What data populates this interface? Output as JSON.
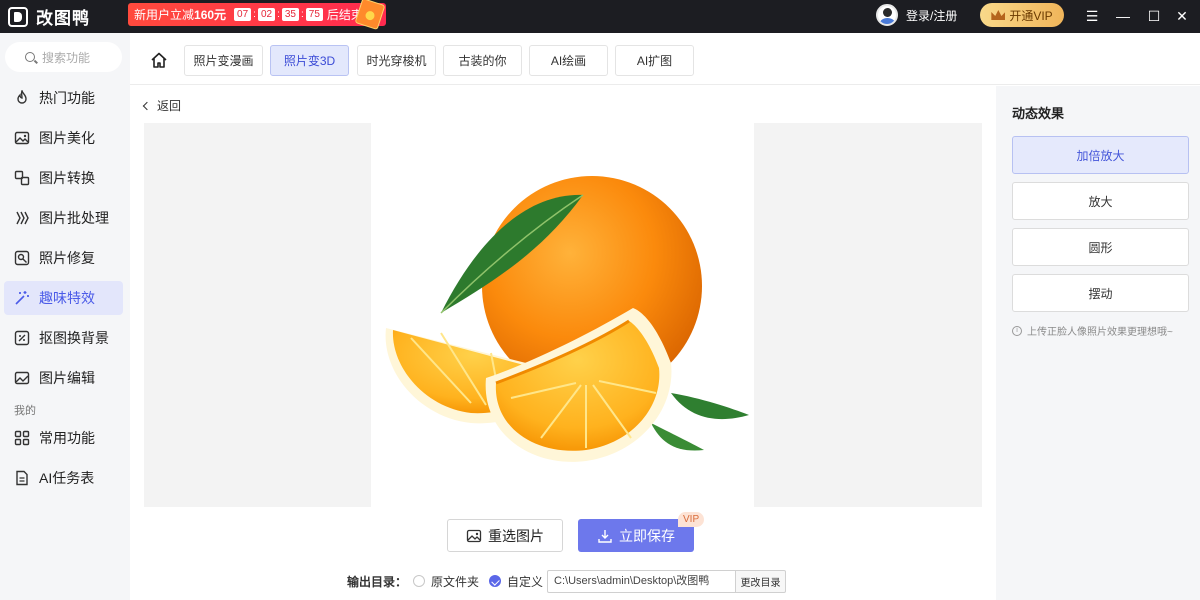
{
  "app": {
    "name": "改图鸭"
  },
  "promo": {
    "text": "新用户立减",
    "amount": "160元",
    "countdown": [
      "07",
      "02",
      "35",
      "75"
    ],
    "suffix": "后结束"
  },
  "user": {
    "login": "登录/注册"
  },
  "vip": {
    "label": "开通VIP"
  },
  "window": {
    "menu": "☰",
    "minimize": "—",
    "maximize": "☐",
    "close": "✕"
  },
  "sidebar": {
    "search_placeholder": "搜索功能",
    "items": [
      {
        "label": "热门功能",
        "icon": "flame-icon"
      },
      {
        "label": "图片美化",
        "icon": "image-beautify-icon"
      },
      {
        "label": "图片转换",
        "icon": "convert-icon"
      },
      {
        "label": "图片批处理",
        "icon": "batch-icon"
      },
      {
        "label": "照片修复",
        "icon": "photo-repair-icon"
      },
      {
        "label": "趣味特效",
        "icon": "magic-wand-icon",
        "active": true
      },
      {
        "label": "抠图换背景",
        "icon": "cutout-icon"
      },
      {
        "label": "图片编辑",
        "icon": "image-edit-icon"
      }
    ],
    "section_label": "我的",
    "my_items": [
      {
        "label": "常用功能",
        "icon": "grid-icon"
      },
      {
        "label": "AI任务表",
        "icon": "task-list-icon"
      }
    ]
  },
  "tabs": [
    {
      "label": "照片变漫画"
    },
    {
      "label": "照片变3D",
      "active": true
    },
    {
      "label": "时光穿梭机"
    },
    {
      "label": "古装的你"
    },
    {
      "label": "AI绘画"
    },
    {
      "label": "AI扩图"
    }
  ],
  "main": {
    "back": "返回",
    "reselect": "重选图片",
    "save": "立即保存",
    "vip_badge": "VIP",
    "output_label": "输出目录：",
    "option_original": "原文件夹",
    "option_custom": "自定义",
    "path": "C:\\Users\\admin\\Desktop\\改图鸭",
    "change_dir": "更改目录"
  },
  "effects_panel": {
    "title": "动态效果",
    "effects": [
      {
        "label": "加倍放大",
        "active": true
      },
      {
        "label": "放大"
      },
      {
        "label": "圆形"
      },
      {
        "label": "摆动"
      }
    ],
    "hint": "上传正脸人像照片效果更理想哦~"
  },
  "colors": {
    "accent": "#6d78ec",
    "active_bg": "#e3e6fb",
    "titlebar": "#1c1d22",
    "promo": "#ff3a45"
  }
}
